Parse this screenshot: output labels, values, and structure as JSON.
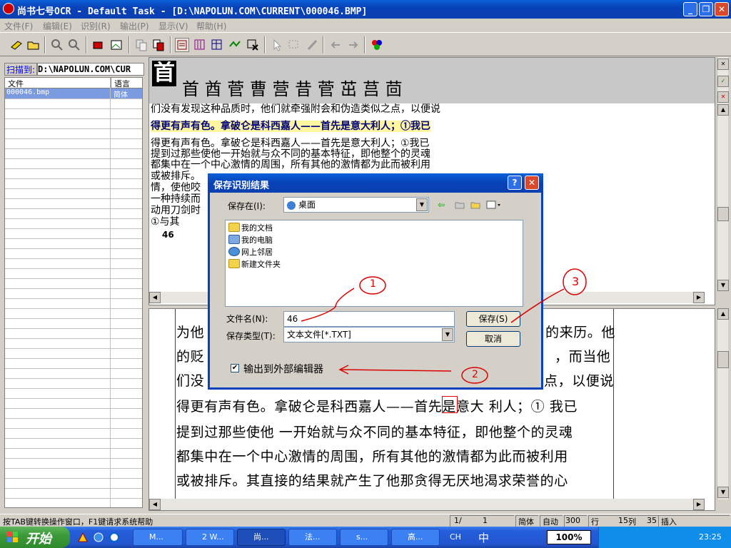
{
  "window": {
    "title": "尚书七号OCR - Default Task - [D:\\NAPOLUN.COM\\CURRENT\\000046.BMP]",
    "minimize": "_",
    "restore": "❐",
    "close": "✕"
  },
  "menu": [
    "文件(F)",
    "编辑(E)",
    "识别(R)",
    "输出(P)",
    "显示(V)",
    "帮助(H)"
  ],
  "left_panel": {
    "scan_label": "扫描到:",
    "scan_path": "D:\\NAPOLUN.COM\\CUR",
    "columns": [
      "文件",
      "语言"
    ],
    "rows": [
      {
        "file": "000046.bmp",
        "lang": "简体"
      }
    ]
  },
  "char_candidates": {
    "main": "首",
    "candidates": "首 酋 菅 曹  营 昔 菅 茁  莒 茴"
  },
  "ocr_result": {
    "lines": [
      "们没有发现这种品质时，他们就牵强附会和伪造类似之点，以便说",
      "得更有声有色。拿破仑是科西嘉人——首先是意大利人；①我已",
      "得更有声有色。拿破仑是科西嘉人——首先是意大利人；①我已",
      "提到过那些使他一开始就与众不同的基本特征，即他整个的灵魂",
      "都集中在一个中心激情的周围，所有其他的激情都为此而被利用",
      "或被排斥。",
      "情，使他咬",
      "一种持续而",
      "动用刀剑时",
      "   ①与其",
      "46"
    ]
  },
  "image_view": {
    "lines": [
      "为他",
      "的贬",
      "们没",
      "得更有声有色。拿破仑是科西嘉人——首先是意大 利人；① 我已",
      "提到过那些使他 一开始就与众不同的基本特征，即他整个的灵魂",
      "都集中在一个中心激情的周围，所有其他的激情都为此而被利用",
      "或被排斥。其直接的结果就产生了他那贪得无厌地渴求荣誉的心"
    ],
    "right_fragments": [
      "的来历。他",
      "，而当他",
      "点，以便说"
    ]
  },
  "dialog": {
    "title": "保存识别结果",
    "help": "?",
    "close": "✕",
    "save_in_label": "保存在(I):",
    "save_in_value": "桌面",
    "folders": [
      "我的文档",
      "我的电脑",
      "网上邻居",
      "新建文件夹"
    ],
    "filename_label": "文件名(N):",
    "filename_value": "46",
    "filetype_label": "保存类型(T):",
    "filetype_value": "文本文件[*.TXT]",
    "save_button": "保存(S)",
    "cancel_button": "取消",
    "external_editor_label": "输出到外部编辑器",
    "external_editor_checked": true
  },
  "annotations": [
    "1",
    "2",
    "3"
  ],
  "status": {
    "hint": "按TAB键转换操作窗口，F1键请求系统帮助",
    "page": "1/",
    "page_num": "1",
    "lang": "简体",
    "mode": "自动",
    "dpi": "300",
    "row_label": "行",
    "row_value": "15",
    "col_label": "列",
    "col_value": "35",
    "insert": "插入"
  },
  "taskbar": {
    "start": "开始",
    "tasks": [
      "M...",
      "2 W...",
      "尚...",
      "法...",
      "s...",
      "高..."
    ],
    "tray": {
      "ime": "CH",
      "lang_char": "中",
      "zoom": "100%",
      "clock": "23:25"
    }
  }
}
